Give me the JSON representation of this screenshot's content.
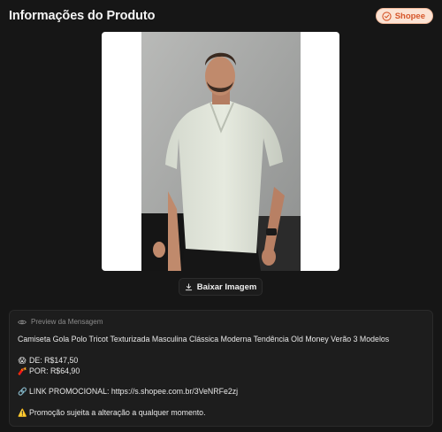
{
  "header": {
    "title": "Informações do Produto",
    "store_badge": "Shopee",
    "store_icon": "shopee-icon"
  },
  "product_image": {
    "download_label": "Baixar Imagem",
    "download_icon": "download-icon"
  },
  "message_preview": {
    "label": "Preview da Mensagem",
    "label_icon": "eye-icon",
    "product_name": "Camiseta Gola Polo Tricot Texturizada Masculina Clássica Moderna Tendência Old Money Verão 3 Modelos",
    "price_from": "DE: R$147,50",
    "price_to": "POR: R$64,90",
    "link": "LINK PROMOCIONAL: https://s.shopee.com.br/3VeNRFe2zj",
    "warning": "Promoção sujeita a alteração a qualquer momento.",
    "icons": {
      "price_from": "😱",
      "price_to": "🧨",
      "link": "🔗",
      "warning": "⚠️"
    }
  },
  "colors": {
    "background": "#161616",
    "badge_bg": "#fbe3d4",
    "badge_text": "#d6562a",
    "card_bg": "#1d1d1d"
  }
}
